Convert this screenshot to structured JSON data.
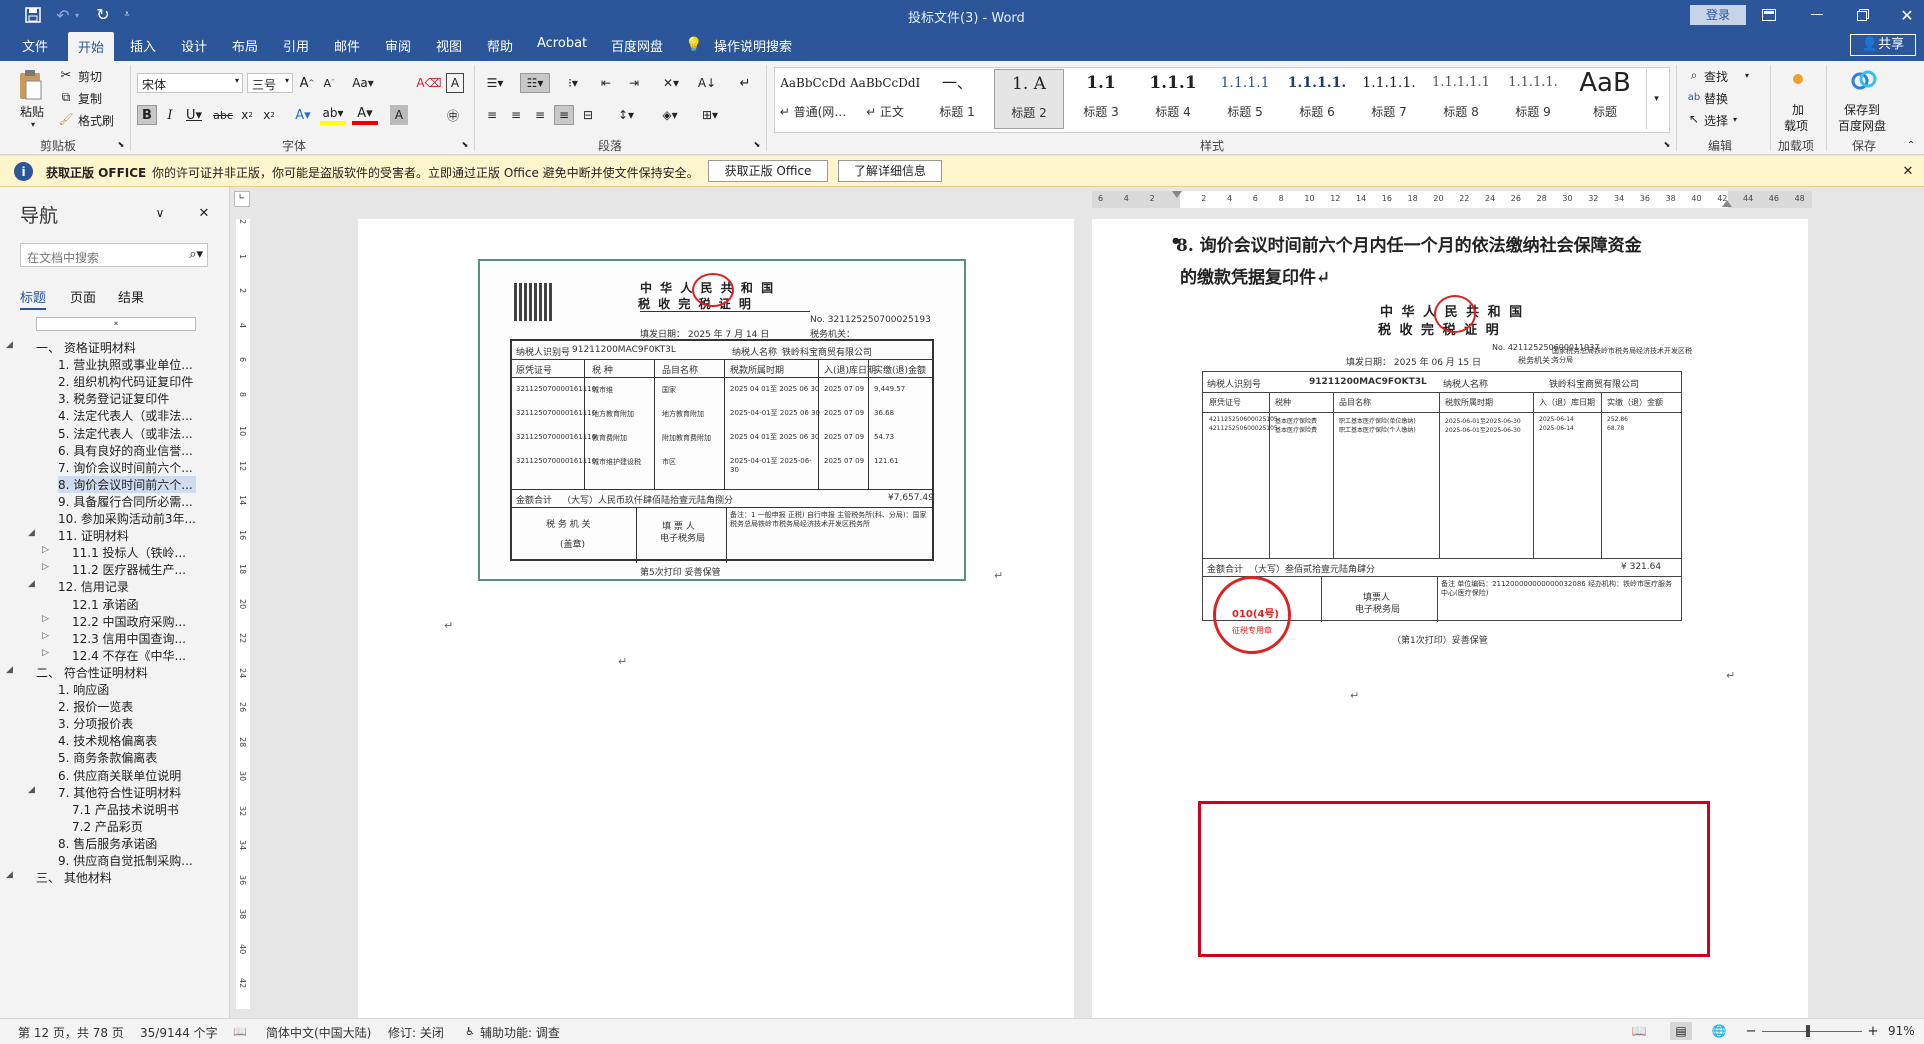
{
  "window": {
    "title": "投标文件(3)  -  Word",
    "login": "登录"
  },
  "ribbon_tabs": [
    "文件",
    "开始",
    "插入",
    "设计",
    "布局",
    "引用",
    "邮件",
    "审阅",
    "视图",
    "帮助",
    "Acrobat",
    "百度网盘"
  ],
  "tell_me": "操作说明搜索",
  "share": "共享",
  "clipboard": {
    "paste": "粘贴",
    "cut": "剪切",
    "copy": "复制",
    "format_painter": "格式刷",
    "group": "剪贴板"
  },
  "font": {
    "name": "宋体",
    "size": "三号",
    "group": "字体"
  },
  "paragraph": {
    "group": "段落"
  },
  "styles": {
    "group": "样式",
    "items": [
      {
        "sample": "AaBbCcDd",
        "name": "↵ 普通(网…"
      },
      {
        "sample": "AaBbCcDdI",
        "name": "↵ 正文"
      },
      {
        "sample": "一、",
        "name": "标题 1"
      },
      {
        "sample": "1.  A",
        "name": "标题 2"
      },
      {
        "sample": "1.1",
        "name": "标题 3"
      },
      {
        "sample": "1.1.1",
        "name": "标题 4"
      },
      {
        "sample": "1.1.1.1",
        "name": "标题 5"
      },
      {
        "sample": "1.1.1.1.",
        "name": "标题 6"
      },
      {
        "sample": "1.1.1.1.",
        "name": "标题 7"
      },
      {
        "sample": "1.1.1.1.1",
        "name": "标题 8"
      },
      {
        "sample": "1.1.1.1.",
        "name": "标题 9"
      },
      {
        "sample": "AaB",
        "name": "标题"
      }
    ]
  },
  "editing": {
    "find": "查找",
    "replace": "替换",
    "select": "选择",
    "group": "编辑"
  },
  "addins": {
    "label1": "加",
    "label2": "载项",
    "group": "加载项"
  },
  "save": {
    "label1": "保存到",
    "label2": "百度网盘",
    "group": "保存"
  },
  "infobar": {
    "title": "获取正版 OFFICE",
    "message": "你的许可证并非正版，你可能是盗版软件的受害者。立即通过正版 Office 避免中断并使文件保持安全。",
    "btn1": "获取正版 Office",
    "btn2": "了解详细信息"
  },
  "nav": {
    "title": "导航",
    "search_placeholder": "在文档中搜索",
    "tabs": [
      "标题",
      "页面",
      "结果"
    ],
    "items": [
      {
        "level": 1,
        "text": "一、 资格证明材料",
        "toggle": "◢"
      },
      {
        "level": 2,
        "text": "1. 营业执照或事业单位..."
      },
      {
        "level": 2,
        "text": "2. 组织机构代码证复印件"
      },
      {
        "level": 2,
        "text": "3. 税务登记证复印件"
      },
      {
        "level": 2,
        "text": "4. 法定代表人（或非法..."
      },
      {
        "level": 2,
        "text": "5. 法定代表人（或非法..."
      },
      {
        "level": 2,
        "text": "6. 具有良好的商业信誉..."
      },
      {
        "level": 2,
        "text": "7. 询价会议时间前六个..."
      },
      {
        "level": 2,
        "text": "8. 询价会议时间前六个...",
        "selected": true
      },
      {
        "level": 2,
        "text": "9. 具备履行合同所必需..."
      },
      {
        "level": 2,
        "text": "10. 参加采购活动前3年..."
      },
      {
        "level": 2,
        "text": "11. 证明材料",
        "toggle": "◢"
      },
      {
        "level": 3,
        "text": "11.1 投标人（铁岭...",
        "toggle": "▷"
      },
      {
        "level": 3,
        "text": "11.2 医疗器械生产...",
        "toggle": "▷"
      },
      {
        "level": 2,
        "text": "12. 信用记录",
        "toggle": "◢"
      },
      {
        "level": 3,
        "text": "12.1 承诺函"
      },
      {
        "level": 3,
        "text": "12.2 中国政府采购...",
        "toggle": "▷"
      },
      {
        "level": 3,
        "text": "12.3 信用中国查询...",
        "toggle": "▷"
      },
      {
        "level": 3,
        "text": "12.4 不存在《中华...",
        "toggle": "▷"
      },
      {
        "level": 1,
        "text": "二、 符合性证明材料",
        "toggle": "◢"
      },
      {
        "level": 2,
        "text": "1. 响应函"
      },
      {
        "level": 2,
        "text": "2. 报价一览表"
      },
      {
        "level": 2,
        "text": "3. 分项报价表"
      },
      {
        "level": 2,
        "text": "4. 技术规格偏离表"
      },
      {
        "level": 2,
        "text": "5. 商务条款偏离表"
      },
      {
        "level": 2,
        "text": "6. 供应商关联单位说明"
      },
      {
        "level": 2,
        "text": "7. 其他符合性证明材料",
        "toggle": "◢"
      },
      {
        "level": 3,
        "text": "7.1 产品技术说明书"
      },
      {
        "level": 3,
        "text": "7.2 产品彩页"
      },
      {
        "level": 2,
        "text": "8. 售后服务承诺函"
      },
      {
        "level": 2,
        "text": "9. 供应商自觉抵制采购..."
      },
      {
        "level": 1,
        "text": "三、 其他材料",
        "toggle": "◢"
      }
    ]
  },
  "ruler": {
    "ticks": [
      "6",
      "4",
      "2",
      "",
      "2",
      "4",
      "6",
      "8",
      "10",
      "12",
      "14",
      "16",
      "18",
      "20",
      "22",
      "24",
      "26",
      "28",
      "30",
      "32",
      "34",
      "36",
      "38",
      "40",
      "42",
      "44",
      "46",
      "48"
    ],
    "vticks": [
      "2",
      "1",
      "2",
      "4",
      "6",
      "8",
      "10",
      "12",
      "14",
      "16",
      "18",
      "20",
      "22",
      "24",
      "26",
      "28",
      "30",
      "32",
      "34",
      "36",
      "38",
      "40",
      "42"
    ]
  },
  "doc": {
    "heading_line1": "8.  询价会议时间前六个月内任一个月的依法缴纳社会保障资金",
    "heading_line2": "的缴款凭据复印件↵",
    "cert_left": {
      "title1": "中 华 人 民 共 和 国",
      "title2": "税 收 完 税 证 明",
      "no": "No. 321125250700025193",
      "date": "填发日期：    2025  年   7  月   14  日",
      "authority": "税务机关：",
      "taxpayer_id_label": "纳税人识别号",
      "taxpayer_id": "91211200MAC9F0KT3L",
      "taxpayer_name_label": "纳税人名称",
      "taxpayer_name": "铁岭科宝商贸有限公司",
      "headers": [
        "原凭证号",
        "税    种",
        "品目名称",
        "税款所属时期",
        "入(退)库日期",
        "实缴(退)金额"
      ],
      "rows": [
        [
          "321125070000161110",
          "城市维",
          "国家",
          "2025 04 01至 2025 06 30",
          "2025 07 09",
          "9,449.57"
        ],
        [
          "321125070000161110",
          "地方教育附加",
          "地方教育附加",
          "2025-04-01至 2025 06 30",
          "2025 07 09",
          "36.68"
        ],
        [
          "321125070000161110",
          "教育费附加",
          "附加教育费附加",
          "2025 04 01至 2025 06 30",
          "2025 07 09",
          "54.73"
        ],
        [
          "321125070000161110",
          "城市维护建设税",
          "市区",
          "2025-04-01至 2025-06-30",
          "2025 07 09",
          "121.61"
        ]
      ],
      "total_label": "金额合计",
      "total_text": "（大写）人民币玖仟肆佰陆拾壹元陆角捌分",
      "total": "¥7,657.49",
      "tax_authority": "税 务 机 关",
      "seal": "(盖章)",
      "filler": "填 票 人",
      "filler2": "电子税务局",
      "remark": "备注：1 一般申报 正税) 自行申报 主管税务所(科、分局)：国家税务总局铁岭市税务局经济技术开发区税务所",
      "footer": "第5次打印    妥善保管"
    },
    "cert_right": {
      "title1": "中 华 人 民 共 和 国",
      "title2": "税 收 完 税 证 明",
      "no": "No. 421125250600011937",
      "date": "填发日期：  2025  年  06  月  15  日",
      "authority": "税务机关：",
      "authority_name": "国家税务总局铁岭市税务局经济技术开发区税务分局",
      "taxpayer_id_label": "纳税人识别号",
      "taxpayer_id": "91211200MAC9FOKT3L",
      "taxpayer_name_label": "纳税人名称",
      "taxpayer_name": "铁岭科宝商贸有限公司",
      "headers": [
        "原凭证号",
        "税种",
        "品目名称",
        "税款所属时期",
        "入（退）库日期",
        "实缴（退）金额"
      ],
      "rows": [
        [
          "421125250600025105",
          "基本医疗保险费",
          "职工基本医疗保险(单位缴纳)",
          "2025-06-01至2025-06-30",
          "2025-06-14",
          "252.86"
        ],
        [
          "421125250600025105",
          "基本医疗保险费",
          "职工基本医疗保险(个人缴纳)",
          "2025-06-01至2025-06-30",
          "2025-06-14",
          "68.78"
        ]
      ],
      "total_label": "金额合计",
      "total_text": "（大写）叁佰贰拾壹元陆角肆分",
      "total": "¥ 321.64",
      "filler": "填票人",
      "filler2": "电子税务局",
      "remark": "备注 单位编码：211200000000000032086 经办机构：铁岭市医疗服务中心(医疗保险)",
      "footer": "（第1次打印）妥善保管",
      "seal_text": "010(4号)",
      "seal_sub": "征税专用章"
    }
  },
  "status": {
    "page": "第 12 页，共 78 页",
    "words": "35/9144 个字",
    "lang": "简体中文(中国大陆)",
    "revision": "修订: 关闭",
    "accessibility": "辅助功能: 调查",
    "zoom": "91%"
  }
}
